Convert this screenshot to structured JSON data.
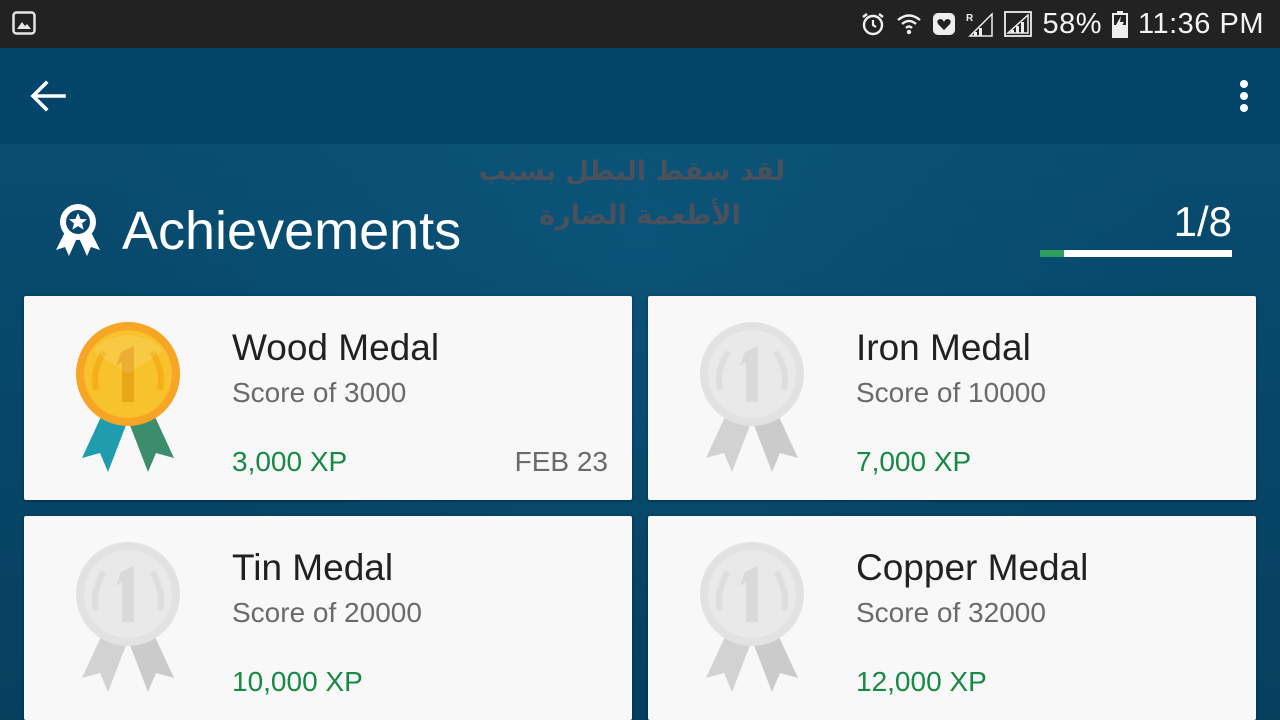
{
  "status_bar": {
    "battery_percent": "58%",
    "time": "11:36 PM",
    "icons": [
      "gallery-icon",
      "alarm-icon",
      "wifi-icon",
      "health-icon",
      "signal-roaming-icon",
      "signal-icon",
      "battery-charging-icon"
    ]
  },
  "app_bar": {
    "back_icon": "arrow-back-icon",
    "menu_icon": "more-vert-icon"
  },
  "watermark": {
    "line1": "لقد سقط البطل بسبب",
    "line2": "الأطعمة الضارة"
  },
  "header": {
    "icon": "ribbon-award-icon",
    "title": "Achievements",
    "progress_text": "1/8",
    "progress_fraction": 0.125
  },
  "colors": {
    "background": "#07486b",
    "app_bar": "#03446a",
    "status_bar": "#222222",
    "xp_green": "#168a44",
    "progress_green": "#2e9d5e",
    "gold_medal": "#f7c12a",
    "locked_medal": "#dddddd"
  },
  "achievements": [
    {
      "title": "Wood Medal",
      "subtitle": "Score of 3000",
      "xp": "3,000 XP",
      "date": "FEB 23",
      "unlocked": true,
      "medal_icon": "gold-medal-icon"
    },
    {
      "title": "Iron Medal",
      "subtitle": "Score of 10000",
      "xp": "7,000 XP",
      "date": "",
      "unlocked": false,
      "medal_icon": "locked-medal-icon"
    },
    {
      "title": "Tin Medal",
      "subtitle": "Score of 20000",
      "xp": "10,000 XP",
      "date": "",
      "unlocked": false,
      "medal_icon": "locked-medal-icon"
    },
    {
      "title": "Copper Medal",
      "subtitle": "Score of 32000",
      "xp": "12,000 XP",
      "date": "",
      "unlocked": false,
      "medal_icon": "locked-medal-icon"
    }
  ]
}
